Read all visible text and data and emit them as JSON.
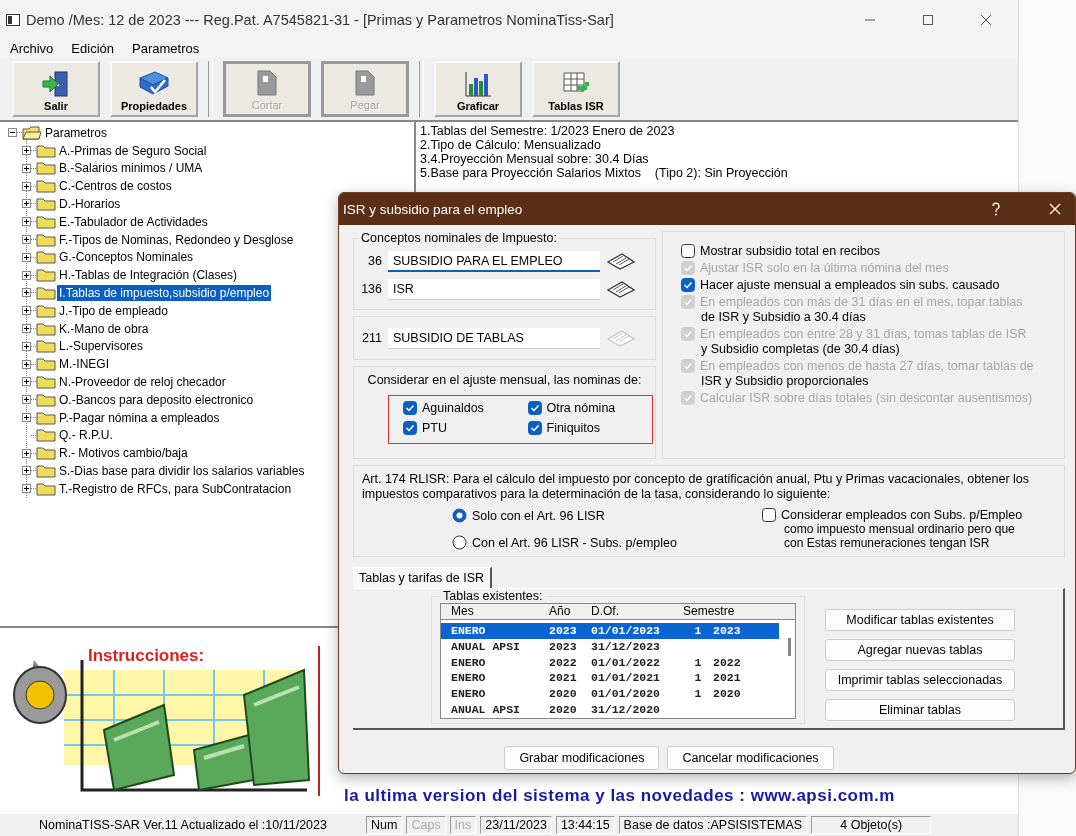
{
  "window": {
    "title": "Demo /Mes: 12 de 2023 --- Reg.Pat. A7545821-31 - [Primas y Parametros NominaTiss-Sar]"
  },
  "menu": [
    "Archivo",
    "Edición",
    "Parametros"
  ],
  "toolbar": [
    {
      "label": "Salir",
      "kind": "exit",
      "disabled": false
    },
    {
      "label": "Propiedades",
      "kind": "properties",
      "disabled": false
    },
    {
      "label": "Cortar",
      "kind": "page",
      "disabled": true
    },
    {
      "label": "Pegar",
      "kind": "page",
      "disabled": true
    },
    {
      "label": "Graficar",
      "kind": "chart",
      "disabled": false
    },
    {
      "label": "Tablas ISR",
      "kind": "grid",
      "disabled": false
    }
  ],
  "tree": {
    "label": "Parametros",
    "expanded": true,
    "children": [
      {
        "label": "A.-Primas de Seguro Social",
        "kind": "branch",
        "selected": false
      },
      {
        "label": "B.-Salarios minimos / UMA",
        "kind": "branch",
        "selected": false
      },
      {
        "label": "C.-Centros de costos",
        "kind": "branch",
        "selected": false
      },
      {
        "label": "D.-Horarios",
        "kind": "branch",
        "selected": false
      },
      {
        "label": "E.-Tabulador de Actividades",
        "kind": "branch",
        "selected": false
      },
      {
        "label": "F.-Tipos de Nominas, Redondeo y Desglose",
        "kind": "branch",
        "selected": false
      },
      {
        "label": "G.-Conceptos Nominales",
        "kind": "branch",
        "selected": false
      },
      {
        "label": "H.-Tablas de Integración (Clases)",
        "kind": "branch",
        "selected": false
      },
      {
        "label": "I.Tablas de impuesto,subsidio p/empleo",
        "kind": "branch",
        "selected": true
      },
      {
        "label": "J.-Tipo de empleado",
        "kind": "branch",
        "selected": false
      },
      {
        "label": "K.-Mano de obra",
        "kind": "branch",
        "selected": false
      },
      {
        "label": "L.-Supervisores",
        "kind": "branch",
        "selected": false
      },
      {
        "label": "M.-INEGI",
        "kind": "branch",
        "selected": false
      },
      {
        "label": "N.-Proveedor de reloj checador",
        "kind": "branch",
        "selected": false
      },
      {
        "label": "O.-Bancos para deposito electronico",
        "kind": "branch",
        "selected": false
      },
      {
        "label": "P.-Pagar nómina a empleados",
        "kind": "branch",
        "selected": false
      },
      {
        "label": "Q.- R.P.U.",
        "kind": "leaf",
        "selected": false
      },
      {
        "label": "R.- Motivos cambio/baja",
        "kind": "branch",
        "selected": false
      },
      {
        "label": "S.-Dias base para dividir los salarios variables",
        "kind": "branch",
        "selected": false
      },
      {
        "label": "T.-Registro de RFCs, para SubContratacion",
        "kind": "branch",
        "selected": false
      }
    ]
  },
  "info_lines": [
    "1.Tablas del Semestre: 1/2023 Enero de 2023",
    "2.Tipo de Cálculo: Mensualizado",
    "3.4.Proyección Mensual sobre: 30.4 Días",
    "5.Base para Proyección Salarios Mixtos    (Tipo 2): Sin Proyección"
  ],
  "instructions": {
    "title": "Instrucciones:"
  },
  "banner": "la ultima version del sistema y las novedades : www.apsi.com.m",
  "status_bar": [
    {
      "text": "NominaTISS-SAR Ver.11 Actualizado el :10/11/2023",
      "disabled": false
    },
    {
      "text": "Num",
      "disabled": false
    },
    {
      "text": "Caps",
      "disabled": true
    },
    {
      "text": "Ins",
      "disabled": true
    },
    {
      "text": "23/11/2023",
      "disabled": false
    },
    {
      "text": "13:44:15",
      "disabled": false
    },
    {
      "text": "Base de datos :APSISISTEMAS",
      "disabled": false
    },
    {
      "text": "4 Objeto(s)",
      "disabled": false
    }
  ],
  "dialog": {
    "title": "ISR y subsidio para el empleo",
    "concepts": {
      "legend": "Conceptos nominales de Impuesto:",
      "rows": [
        {
          "code": "36",
          "value": "SUBSIDIO PARA EL EMPLEO",
          "focused": true
        },
        {
          "code": "136",
          "value": "ISR",
          "focused": false
        }
      ]
    },
    "tables_concept": {
      "code": "211",
      "value": "SUBSIDIO DE TABLAS",
      "disabled": true
    },
    "monthly": {
      "legend": "Considerar en el ajuste mensual, las nominas de:",
      "options": [
        {
          "label": "Aguinaldos",
          "checked": true
        },
        {
          "label": "Otra nómina",
          "checked": true
        },
        {
          "label": "PTU",
          "checked": true
        },
        {
          "label": "Finiquitos",
          "checked": true
        }
      ]
    },
    "settings": [
      {
        "label": "Mostrar subsidio total en recibos",
        "checked": false,
        "disabled": false
      },
      {
        "label": "Ajustar ISR solo en la última nómina del mes",
        "checked": true,
        "disabled": true
      },
      {
        "label": "Hacer ajuste mensual a empleados sin subs. causado",
        "checked": true,
        "disabled": false
      },
      {
        "label": "En empleados con más de 31 días en el mes, topar tablas",
        "note": "de ISR y Subsidio a 30.4 días",
        "checked": true,
        "disabled": true
      },
      {
        "label": "En empleados con entre 28 y 31 días, tomas tablas de ISR",
        "note": "y Subsidio completas (de 30.4 días)",
        "checked": true,
        "disabled": true
      },
      {
        "label": "En empleados con menos de hasta 27 días, tomar tablas de",
        "note": "ISR y Subsidio proporcionales",
        "checked": true,
        "disabled": true
      },
      {
        "label": "Calcular ISR sobre días totales (sin descontar ausentismos)",
        "checked": true,
        "disabled": true
      }
    ],
    "art174": {
      "text": "Art. 174 RLISR: Para el cálculo del impuesto por concepto de gratificación anual, Ptu y Primas vacacionales, obtener los impuestos comparativos para la determinación de la tasa, considerando lo siguiente:",
      "radios": [
        {
          "label": "Solo con el Art. 96 LISR",
          "selected": true
        },
        {
          "label": "Con el Art. 96 LISR - Subs. p/empleo",
          "selected": false
        }
      ],
      "option": {
        "label": "Considerar empleados con Subs. p/Empleo",
        "notes": [
          "como impuesto mensual ordinario pero que",
          "con Estas remuneraciones tengan ISR"
        ],
        "checked": false
      }
    },
    "tabs": [
      {
        "label": "Tablas y tarifas de ISR",
        "selected": true
      }
    ],
    "tables": {
      "legend": "Tablas existentes:",
      "columns": [
        "Mes",
        "Año",
        "D.Of.",
        "Semestre"
      ],
      "rows": [
        {
          "cells": [
            "ENERO",
            "2023",
            "01/01/2023",
            "1",
            "2023"
          ],
          "selected": true
        },
        {
          "cells": [
            "ANUAL APSI",
            "2023",
            "31/12/2023",
            "",
            ""
          ],
          "selected": false
        },
        {
          "cells": [
            "ENERO",
            "2022",
            "01/01/2022",
            "1",
            "2022"
          ],
          "selected": false
        },
        {
          "cells": [
            "ENERO",
            "2021",
            "01/01/2021",
            "1",
            "2021"
          ],
          "selected": false
        },
        {
          "cells": [
            "ENERO",
            "2020",
            "01/01/2020",
            "1",
            "2020"
          ],
          "selected": false
        },
        {
          "cells": [
            "ANUAL APSI",
            "2020",
            "31/12/2020",
            "",
            ""
          ],
          "selected": false
        }
      ]
    },
    "table_buttons": [
      "Modificar tablas existentes",
      "Agregar nuevas tablas",
      "Imprimir tablas seleccionadas",
      "Eliminar tablas"
    ],
    "buttons": [
      "Grabar modificaciones",
      "Cancelar modificaciones"
    ]
  }
}
